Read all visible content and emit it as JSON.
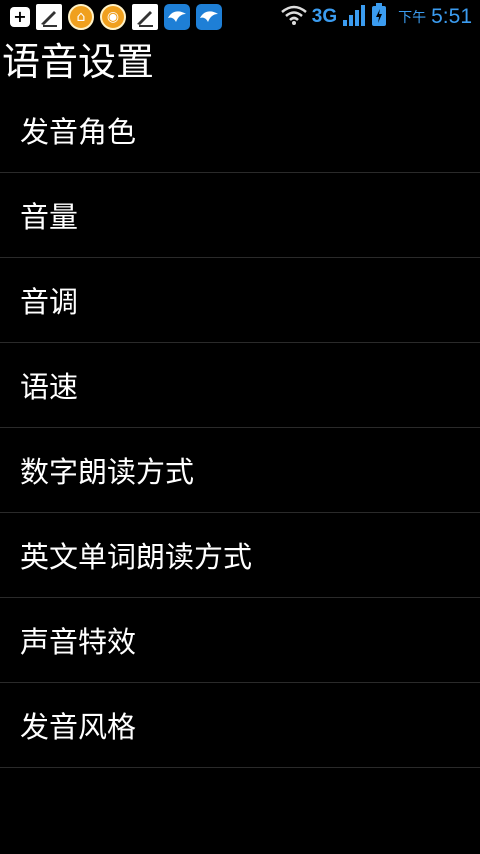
{
  "status_bar": {
    "notification_icons": [
      "add-icon",
      "document-icon",
      "home-app-icon",
      "coin-app-icon",
      "document-icon",
      "bird-app-icon",
      "bird-app-icon",
      "tiles-app-icon"
    ],
    "network_type": "3G",
    "time_prefix": "下午",
    "time": "5:51",
    "colors": {
      "accent": "#3b9cf0",
      "background": "#000000"
    }
  },
  "title": "语音设置",
  "settings": [
    {
      "label": "发音角色"
    },
    {
      "label": "音量"
    },
    {
      "label": "音调"
    },
    {
      "label": "语速"
    },
    {
      "label": "数字朗读方式"
    },
    {
      "label": "英文单词朗读方式"
    },
    {
      "label": "声音特效"
    },
    {
      "label": "发音风格"
    }
  ]
}
